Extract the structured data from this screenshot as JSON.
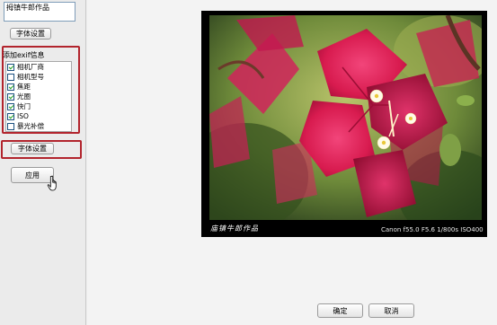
{
  "sidebar": {
    "signature_text": "拇镇牛郎作品",
    "font_button_1": "字体设置",
    "exif_title": "添加exif信息",
    "exif_items": [
      {
        "label": "相机厂商",
        "checked": true
      },
      {
        "label": "相机型号",
        "checked": false
      },
      {
        "label": "焦距",
        "checked": true
      },
      {
        "label": "光圈",
        "checked": true
      },
      {
        "label": "快门",
        "checked": true
      },
      {
        "label": "ISO",
        "checked": true
      },
      {
        "label": "暴光补偿",
        "checked": false
      }
    ],
    "font_button_2": "字体设置",
    "apply_button": "应用"
  },
  "preview": {
    "signature": "庙镇牛郎作品",
    "exif_line": "Canon f55.0 F5.6 1/800s ISO400"
  },
  "footer": {
    "ok_button": "确定",
    "cancel_button": "取消"
  },
  "colors": {
    "highlight_border": "#b2242d",
    "checkmark": "#21a121",
    "bougainvillea": "#d81b4f"
  },
  "icons": {
    "cursor": "hand-pointer-icon"
  }
}
